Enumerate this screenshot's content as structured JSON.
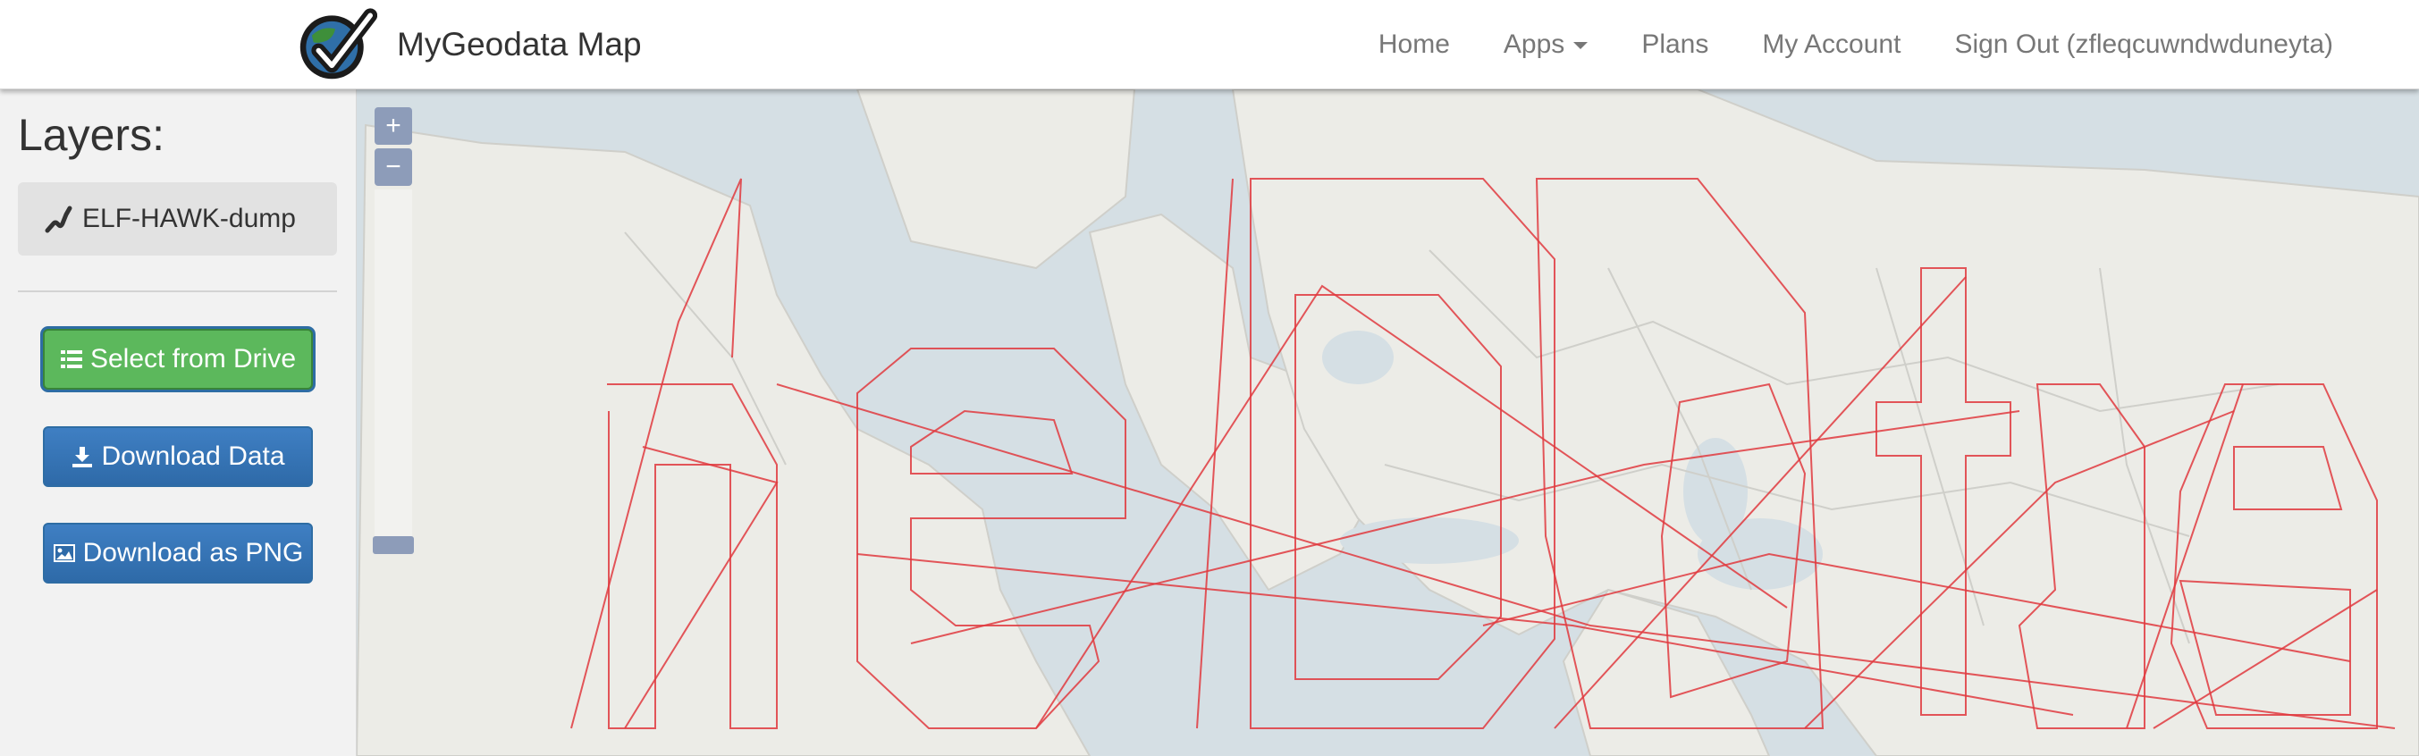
{
  "navbar": {
    "brand_name": "MyGeodata Map",
    "links": {
      "home": "Home",
      "apps": "Apps",
      "plans": "Plans",
      "account": "My Account",
      "signout": "Sign Out (zfleqcuwndwduneyta)"
    }
  },
  "sidebar": {
    "title": "Layers:",
    "layer_name": "ELF-HAWK-dump",
    "buttons": {
      "select_drive": "Select from Drive",
      "download_data": "Download Data",
      "download_png": "Download as PNG"
    }
  },
  "map": {
    "zoom_in": "+",
    "zoom_out": "−",
    "feature_color": "#e0393e",
    "ocean_color": "#d5dfe4",
    "land_color": "#ecece7"
  },
  "colors": {
    "primary_blue": "#337ab7",
    "success_green": "#5cb85c"
  }
}
